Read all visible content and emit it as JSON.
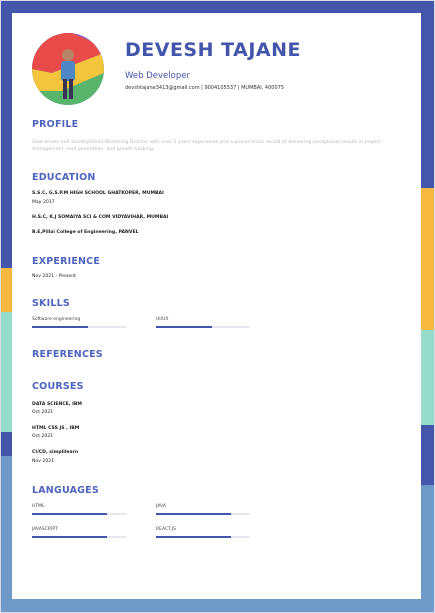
{
  "header": {
    "name": "DEVESH TAJANE",
    "role": "Web Developer",
    "contact": "devshtajane3413@gmail.com | 9004105537 | MUMBAI, 400075"
  },
  "profile": {
    "title": "PROFILE",
    "text": "Goal-driven and accomplished Marketing Director with over 5 years experience and a proven track record of delivering exceptional results in project management, lead generation, and growth hacking."
  },
  "education": {
    "title": "EDUCATION",
    "items": [
      {
        "school": "S.S.C, G.S.P.M HIGH SCHOOL GHATKOPER, MUMBAI",
        "date": "May 2017"
      },
      {
        "school": "H.S.C, K.J SOMAIYA SCI & COM VIDYAVIHAR, MUMBAI",
        "date": ""
      },
      {
        "school": "B.E,Pillai College of Engineering, PANVEL",
        "date": ""
      }
    ]
  },
  "experience": {
    "title": "EXPERIENCE",
    "items": [
      {
        "date": "Nov 2021 - Present"
      }
    ]
  },
  "skills": {
    "title": "SKILLS",
    "items": [
      {
        "label": "Software engineering",
        "level": 0.6
      },
      {
        "label": "UI/UX",
        "level": 0.6
      }
    ]
  },
  "references": {
    "title": "REFERENCES"
  },
  "courses": {
    "title": "COURSES",
    "items": [
      {
        "name": "DATA SCIENCE, IBM",
        "date": "Oct 2021"
      },
      {
        "name": "HTML CSS JS , IBM",
        "date": "Oct 2021"
      },
      {
        "name": "CI/CD, simplilearn",
        "date": "Nov 2021"
      }
    ]
  },
  "languages": {
    "title": "LANGUAGES",
    "items": [
      {
        "label": "HTML",
        "level": 0.8
      },
      {
        "label": "JAVA",
        "level": 0.8
      },
      {
        "label": "JAVASCRIPT",
        "level": 0.8
      },
      {
        "label": "REACT.JS",
        "level": 0.8
      }
    ]
  },
  "colors": {
    "primary": "#4456ab",
    "accent_yellow": "#f6b83f",
    "accent_mint": "#97dccb",
    "accent_light_blue": "#6f9ac8"
  }
}
